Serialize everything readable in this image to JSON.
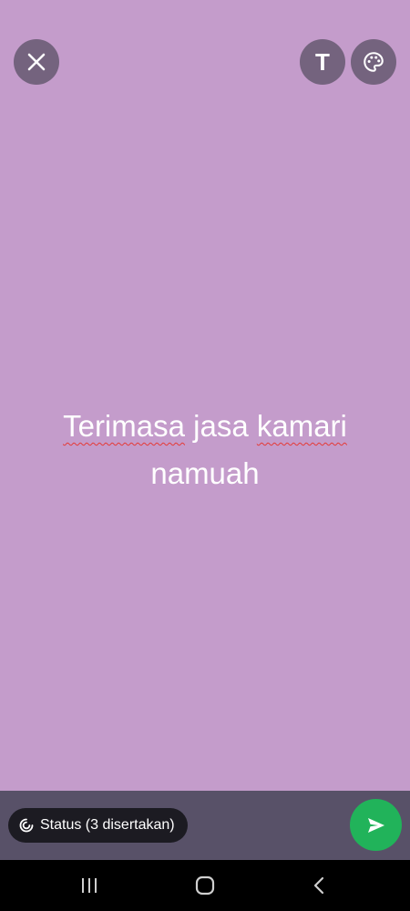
{
  "colors": {
    "background": "#c49ccb",
    "bottom_bar": "#585168",
    "send_accent": "#21b35a",
    "spellcheck": "#e53935"
  },
  "toolbar": {
    "close_icon": "close-icon",
    "text_tool_label": "T",
    "palette_icon": "palette-icon"
  },
  "status": {
    "words": [
      "Terimasa",
      "jasa",
      "kamari",
      "namuah"
    ]
  },
  "footer": {
    "audience_label": "Status (3 disertakan)",
    "audience_icon": "status-ring-icon",
    "send_icon": "send-icon"
  },
  "nav": {
    "recent_icon": "recent-apps-icon",
    "home_icon": "home-icon",
    "back_icon": "back-icon"
  }
}
